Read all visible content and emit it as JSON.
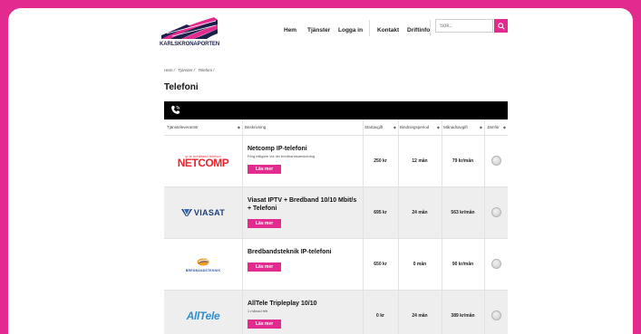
{
  "header": {
    "logo_text": "KARLSKRONAPORTEN",
    "nav": [
      "Hem",
      "Tjänster",
      "Logga in",
      "Kontakt",
      "Driftinfo"
    ],
    "search_placeholder": "Sök.."
  },
  "breadcrumb": [
    "Hem /",
    "Tjänster /",
    "Telefoni /"
  ],
  "page_title": "Telefoni",
  "table": {
    "columns": [
      "Tjänsteleverantör",
      "Beskrivning",
      "Startavgift",
      "Bindningsperiod",
      "Månadsavgift",
      "Jämför"
    ],
    "rows": [
      {
        "provider": "NETCOMP",
        "provider_tagline": "ip-tv bredband telefoni",
        "title": "Netcomp IP-telefoni",
        "sub": "Ring billigare via din bredbandsanslutning",
        "button": "Läs mer",
        "start": "250 kr",
        "binding": "12 mån",
        "monthly": "79 kr/mån"
      },
      {
        "provider": "VIASAT",
        "title": "Viasat IPTV + Bredband 10/10 Mbit/s + Telefoni",
        "sub": "",
        "button": "Läs mer",
        "start": "695 kr",
        "binding": "24 mån",
        "monthly": "563 kr/mån"
      },
      {
        "provider": "BREDBANDSTEKNIK",
        "title": "Bredbandsteknik IP-telefoni",
        "sub": "",
        "button": "Läs mer",
        "start": "650 kr",
        "binding": "0 mån",
        "monthly": "90 kr/mån"
      },
      {
        "provider": "AllTele",
        "title": "AllTele Tripleplay 10/10",
        "sub": "1 månad fritt",
        "button": "Läs mer",
        "start": "0 kr",
        "binding": "24 mån",
        "monthly": "389 kr/mån"
      }
    ]
  },
  "colors": {
    "accent": "#e32b8f",
    "navy": "#1c1f4a"
  }
}
